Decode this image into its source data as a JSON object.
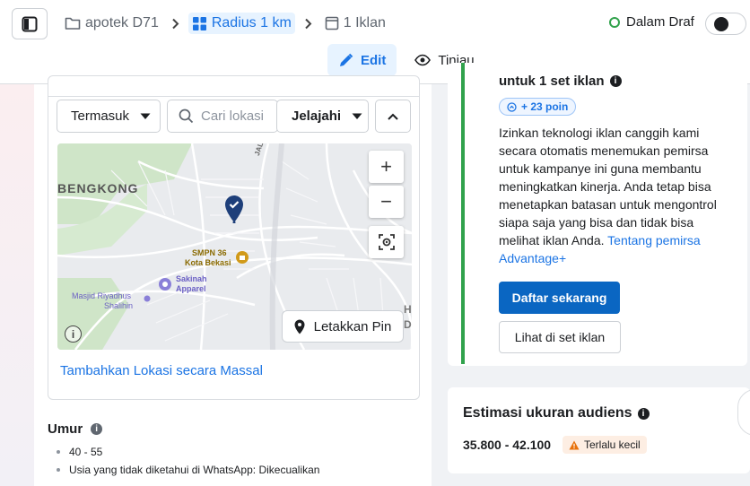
{
  "header": {
    "breadcrumbs": [
      {
        "label": "apotek D71",
        "icon": "folder-icon"
      },
      {
        "label": "Radius 1 km",
        "icon": "grid-icon"
      },
      {
        "label": "1 Iklan",
        "icon": "ad-window-icon"
      }
    ],
    "status_label": "Dalam Draf",
    "tabs": [
      {
        "label": "Edit",
        "icon": "pencil-icon"
      },
      {
        "label": "Tinjau",
        "icon": "eye-icon"
      }
    ]
  },
  "location": {
    "include_label": "Termasuk",
    "search_placeholder": "Cari lokasi",
    "explore_label": "Jelajahi",
    "map": {
      "labels": {
        "area": "BENGKONG",
        "street": "JALAN K",
        "school_1": "SMPN 36",
        "school_2": "Kota Bekasi",
        "store_1": "Sakinah",
        "store_2": "Apparel",
        "mosque_1": "Masjid Riyadhus",
        "mosque_2": "Shalihin",
        "edge_1": "H",
        "edge_2": "D"
      },
      "zoom_in": "+",
      "zoom_out": "−",
      "info": "i"
    },
    "drop_pin_label": "Letakkan Pin",
    "bulk_link": "Tambahkan Lokasi secara Massal"
  },
  "age": {
    "title": "Umur",
    "items": [
      "40 - 55",
      "Usia yang tidak diketahui di WhatsApp: Dikecualikan"
    ]
  },
  "advantage": {
    "heading": "untuk 1 set iklan",
    "points": "+ 23 poin",
    "description": "Izinkan teknologi iklan canggih kami secara otomatis menemukan pemirsa untuk kampanye ini guna membantu meningkatkan kinerja. Anda tetap bisa menetapkan batasan untuk mengontrol siapa saja yang bisa dan tidak bisa melihat iklan Anda.",
    "link": "Tentang pemirsa Advantage+",
    "primary_button": "Daftar sekarang",
    "secondary_button": "Lihat di set iklan"
  },
  "audience": {
    "title": "Estimasi ukuran audiens",
    "range": "35.800 - 42.100",
    "warning": "Terlalu kecil"
  },
  "colors": {
    "accent": "#1b74e4",
    "primary_button": "#0a66c2",
    "success": "#31a24c",
    "warning": "#e8710a"
  }
}
